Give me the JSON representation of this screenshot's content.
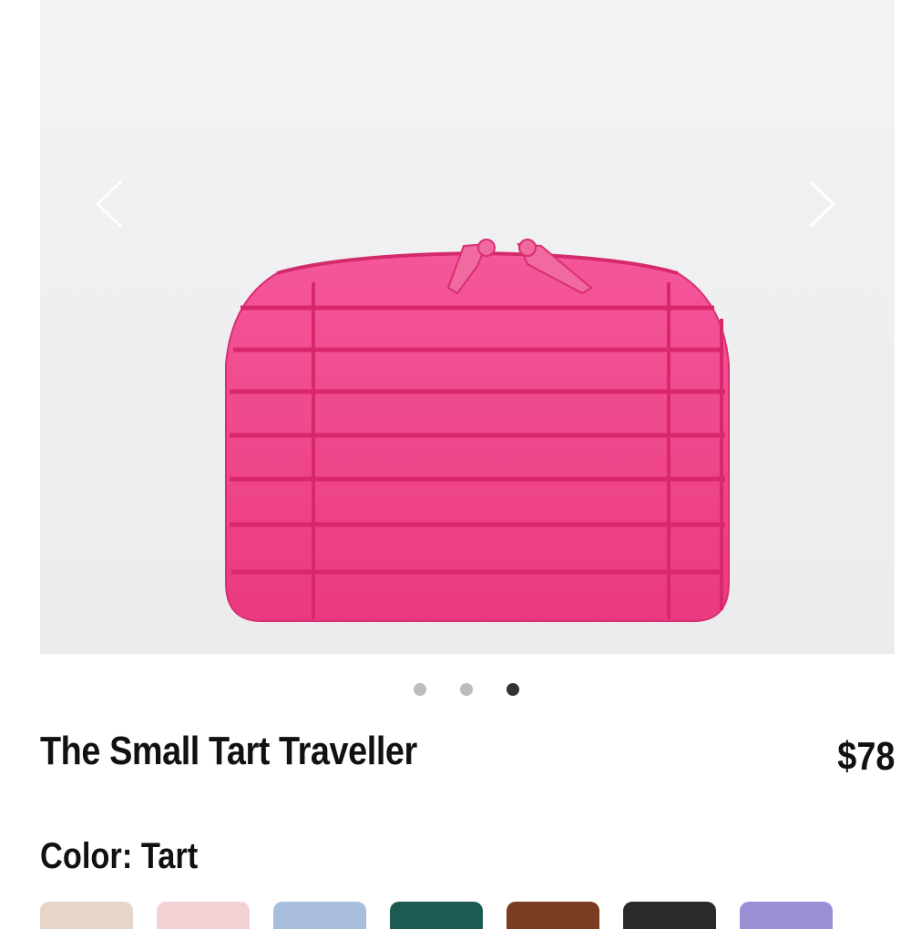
{
  "product": {
    "title": "The Small Tart Traveller",
    "price": "$78",
    "color_label": "Color: Tart"
  },
  "gallery": {
    "image_count": 3,
    "active_index": 2,
    "prev_icon": "chevron-left-icon",
    "next_icon": "chevron-right-icon"
  },
  "colors": {
    "product": "#ef3f86",
    "dot_inactive": "#bdbdbd",
    "dot_active": "#333333"
  },
  "swatches": [
    {
      "color": "#e5d6c9"
    },
    {
      "color": "#f2d0d4"
    },
    {
      "color": "#a8bedc"
    },
    {
      "color": "#1d5a52"
    },
    {
      "color": "#7a3d22"
    },
    {
      "color": "#2a2a2a"
    },
    {
      "color": "#9b8ed4"
    }
  ]
}
